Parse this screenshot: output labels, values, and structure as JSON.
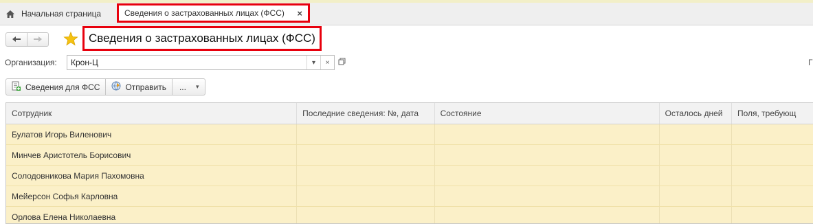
{
  "tabs": {
    "home_label": "Начальная страница",
    "active_label": "Сведения о застрахованных лицах (ФСС)",
    "close_symbol": "×"
  },
  "page": {
    "title": "Сведения о застрахованных лицах (ФСС)"
  },
  "organization": {
    "label": "Организация:",
    "value": "Крон-Ц",
    "dropdown_symbol": "▾",
    "clear_symbol": "×"
  },
  "right_edge_text": "Г",
  "toolbar": {
    "fss_info_label": "Сведения для ФСС",
    "send_label": "Отправить",
    "more_label": "...",
    "more_arrow": "▾"
  },
  "table": {
    "columns": [
      "Сотрудник",
      "Последние сведения: №, дата",
      "Состояние",
      "Осталось дней",
      "Поля, требующ"
    ],
    "rows": [
      [
        "Булатов Игорь Виленович",
        "",
        "",
        "",
        ""
      ],
      [
        "Минчев Аристотель Борисович",
        "",
        "",
        "",
        ""
      ],
      [
        "Солодовникова Мария Пахомовна",
        "",
        "",
        "",
        ""
      ],
      [
        "Мейерсон Софья Карловна",
        "",
        "",
        "",
        ""
      ],
      [
        "Орлова Елена Николаевна",
        "",
        "",
        "",
        ""
      ]
    ]
  },
  "colors": {
    "highlight_red": "#e8000d",
    "row_background": "#fbf0c8",
    "header_background": "#f2f2f2",
    "star_yellow": "#f5c211"
  }
}
